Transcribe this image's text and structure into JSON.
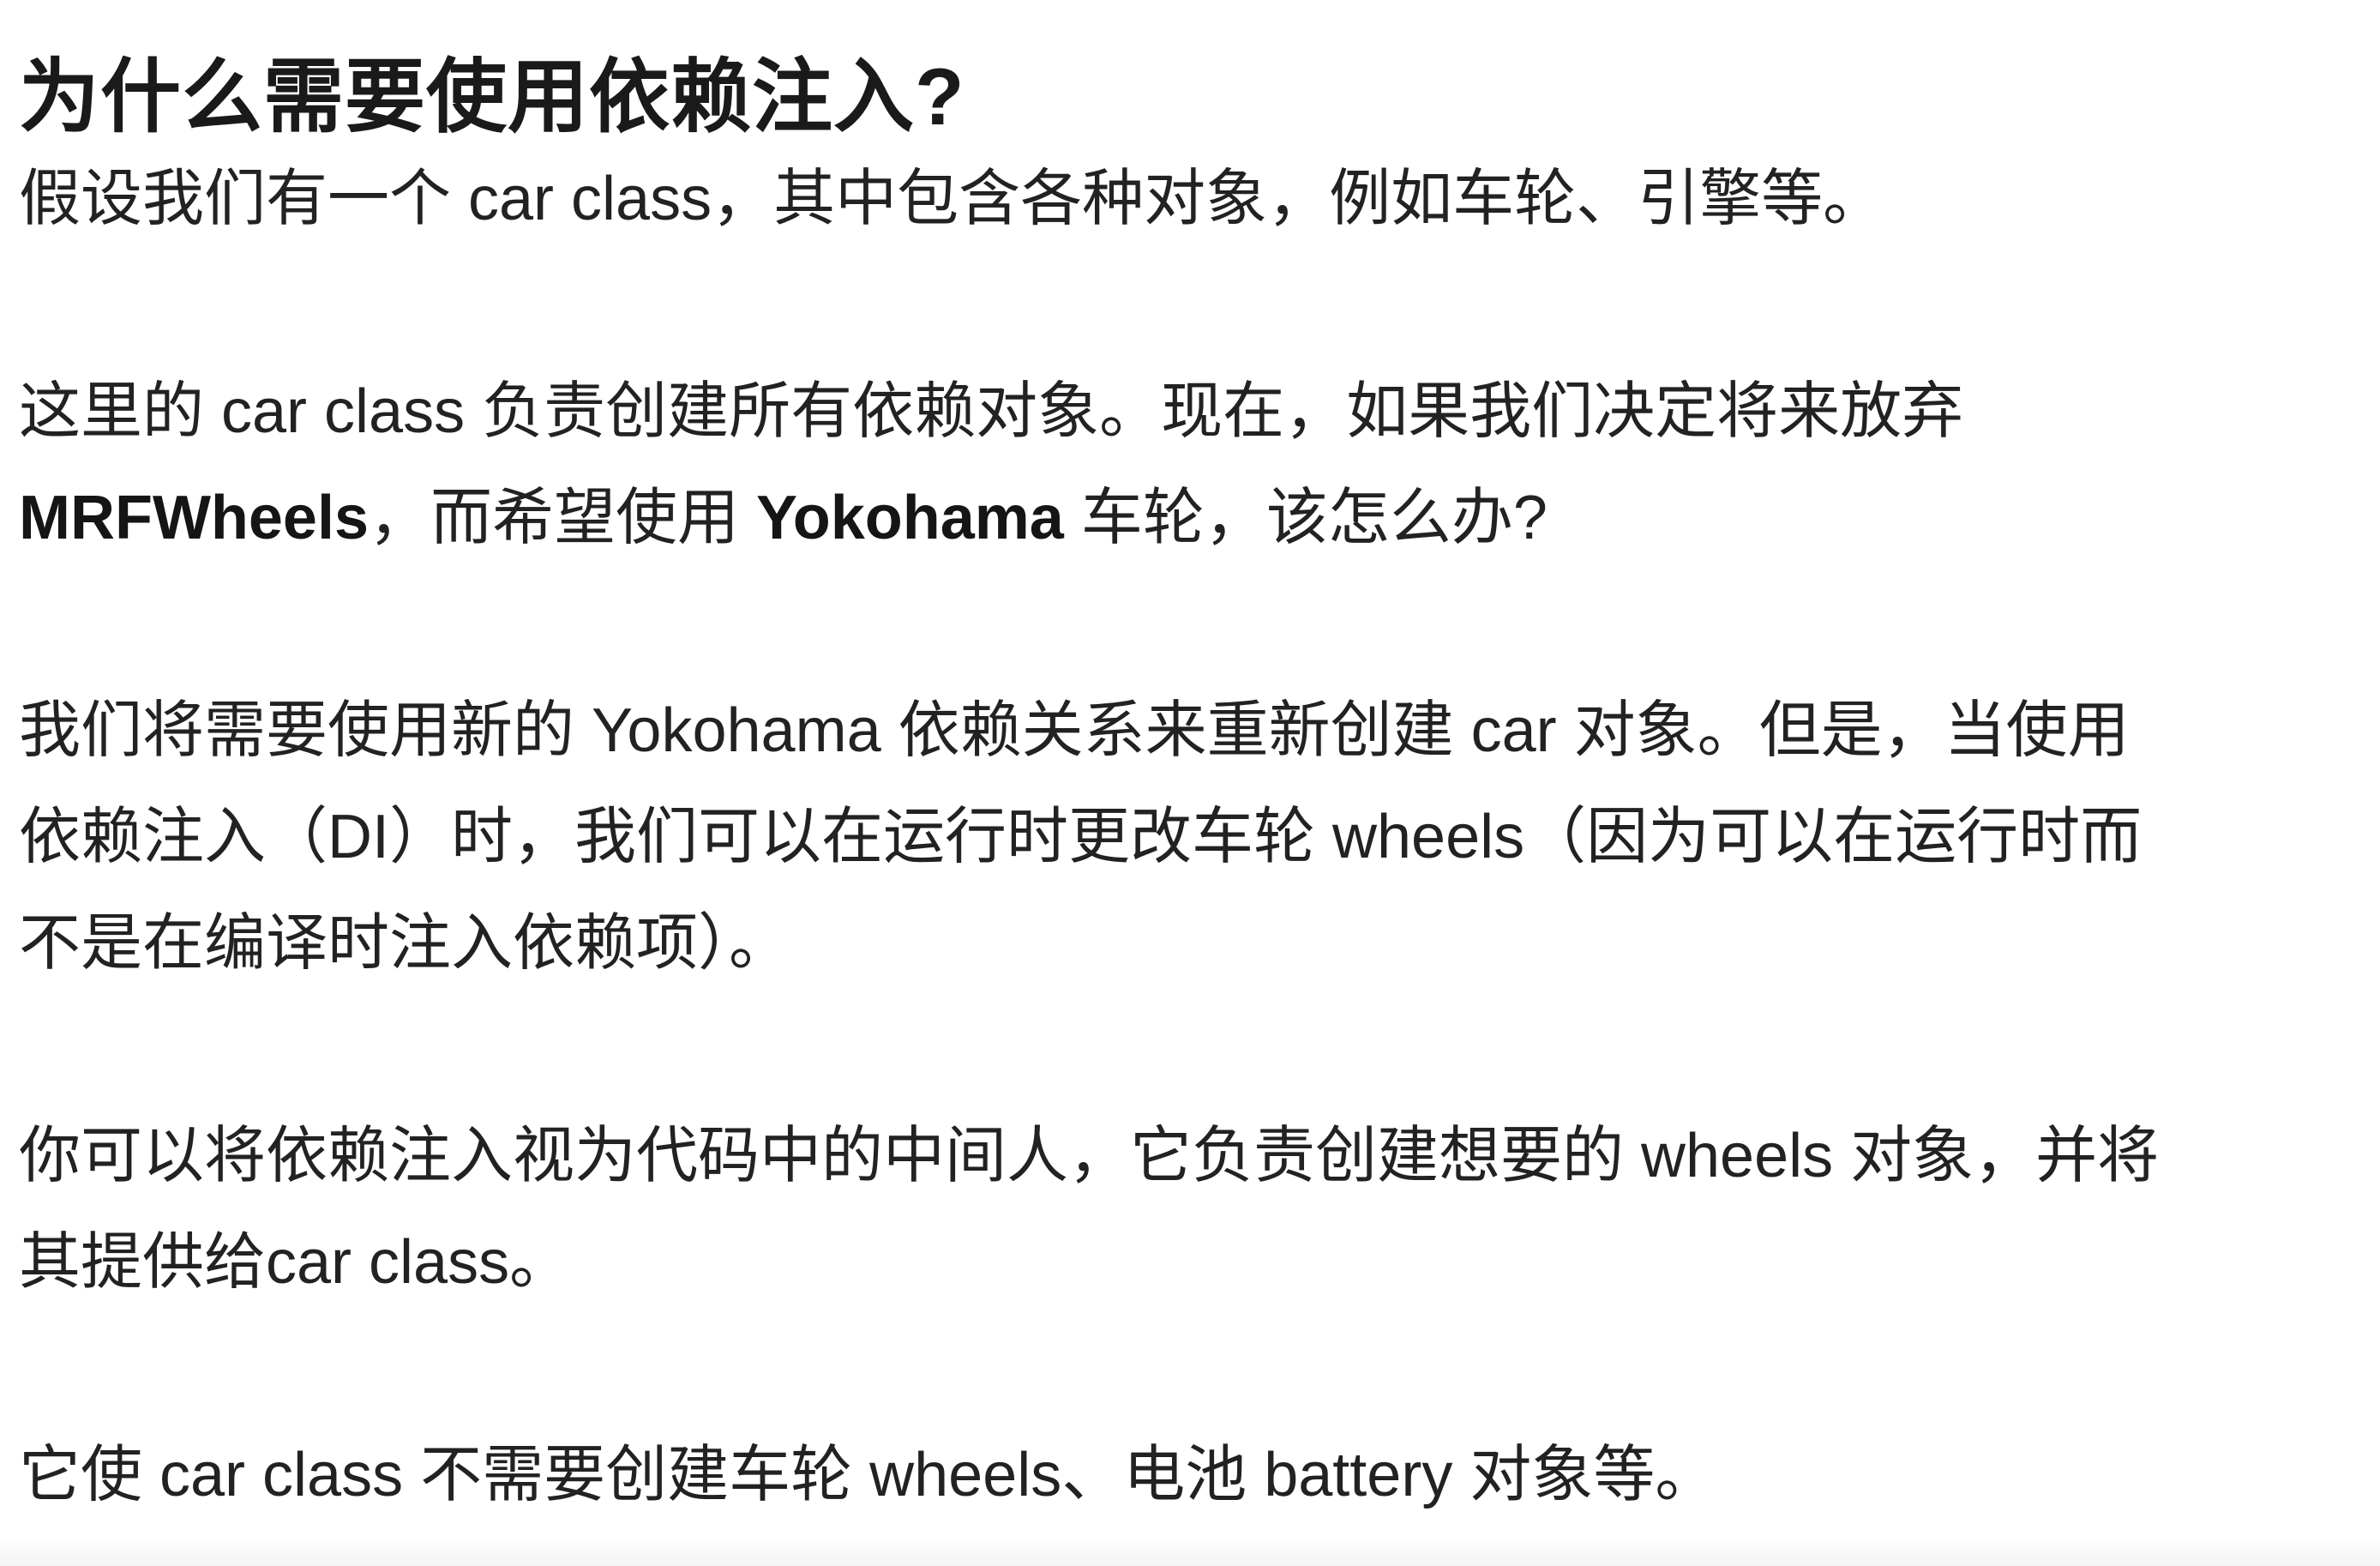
{
  "document": {
    "title": "为什么需要使用依赖注入?",
    "paragraph1": {
      "line1": "假设我们有一个 car class，其中包含各种对象，例如车轮、引擎等。"
    },
    "paragraph2": {
      "line1": "这里的 car class 负责创建所有依赖对象。现在，如果我们决定将来放弃",
      "line2_bold1": "MRFWheels",
      "line2_text1": "，而希望使用 ",
      "line2_bold2": "Yokohama",
      "line2_text2": " 车轮，该怎么办?"
    },
    "paragraph3": {
      "line1": "我们将需要使用新的 Yokohama 依赖关系来重新创建 car 对象。但是，当使用",
      "line2": "依赖注入（DI）时，我们可以在运行时更改车轮 wheels（因为可以在运行时而",
      "line3": "不是在编译时注入依赖项）。"
    },
    "paragraph4": {
      "line1": "你可以将依赖注入视为代码中的中间人，它负责创建想要的 wheels 对象，并将",
      "line2": "其提供给car class。"
    },
    "paragraph5": {
      "line1": "它使 car class 不需要创建车轮 wheels、电池 battery 对象等。"
    }
  }
}
